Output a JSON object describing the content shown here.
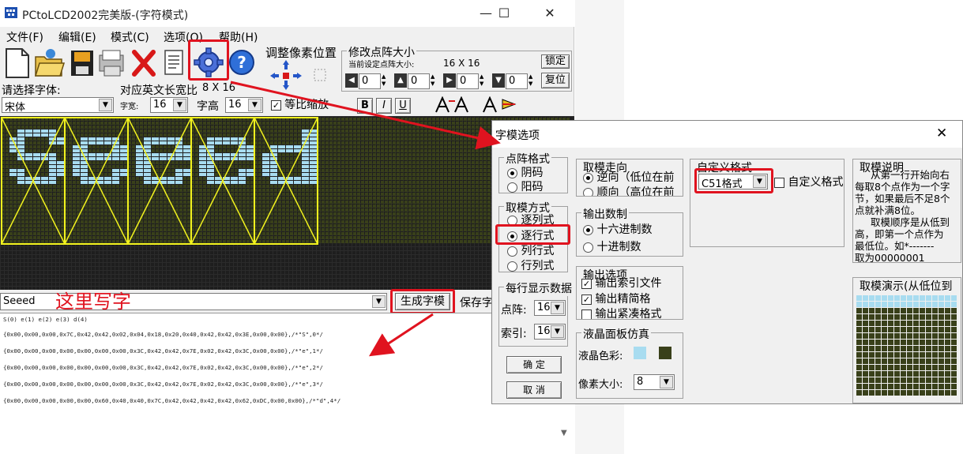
{
  "window": {
    "title": "PCtoLCD2002完美版-(字符模式)",
    "minimize": "—",
    "maximize": "☐",
    "close": "✕"
  },
  "menu": [
    "文件(F)",
    "编辑(E)",
    "模式(C)",
    "选项(O)",
    "帮助(H)"
  ],
  "adjust": {
    "title": "调整像素位置"
  },
  "matrix": {
    "title": "修改点阵大小",
    "current_label": "当前设定点阵大小:",
    "current_value": "16  X  16",
    "lock_button": "锁定",
    "restore_button": "复位",
    "spin_values": [
      "0",
      "0",
      "0",
      "0"
    ]
  },
  "font": {
    "select_label": "请选择字体:",
    "value": "宋体",
    "width_label": "对应英文长宽比",
    "width_ratio": "8  X  16",
    "char_width_label": "字宽:",
    "char_width": "16",
    "char_height_label": "字高",
    "char_height": "16",
    "proportional_label": "等比缩放",
    "bold": "B",
    "italic": "I",
    "underline": "U"
  },
  "lcd": {
    "text": "Seeed",
    "pixel_on": "#a8dcf0",
    "pixel_off": "#39401a",
    "grid_bg": "#1e1e1e",
    "cell_line": "#f2f21e"
  },
  "input": {
    "text": "Seeed",
    "annotation": "这里写字",
    "generate_button": "生成字模",
    "save_button": "保存字"
  },
  "output": {
    "index_line": "S(0) e(1) e(2) e(3) d(4)",
    "lines": [
      "{0x00,0x00,0x00,0x7C,0x42,0x42,0x02,0x04,0x18,0x20,0x40,0x42,0x42,0x3E,0x00,0x00},/*\"S\",0*/",
      "{0x00,0x00,0x00,0x00,0x00,0x00,0x00,0x3C,0x42,0x42,0x7E,0x02,0x42,0x3C,0x00,0x00},/*\"e\",1*/",
      "{0x00,0x00,0x00,0x00,0x00,0x00,0x00,0x3C,0x42,0x42,0x7E,0x02,0x42,0x3C,0x00,0x00},/*\"e\",2*/",
      "{0x00,0x00,0x00,0x00,0x00,0x00,0x00,0x3C,0x42,0x42,0x7E,0x02,0x42,0x3C,0x00,0x00},/*\"e\",3*/",
      "{0x00,0x00,0x00,0x00,0x00,0x60,0x40,0x40,0x7C,0x42,0x42,0x42,0x42,0x62,0xDC,0x00,0x00},/*\"d\",4*/"
    ]
  },
  "dialog": {
    "title": "字模选项",
    "close": "✕",
    "dot_format": {
      "title": "点阵格式",
      "options": [
        "阴码",
        "阳码"
      ],
      "selected": 0
    },
    "mode": {
      "title": "取模方式",
      "options": [
        "逐列式",
        "逐行式",
        "列行式",
        "行列式"
      ],
      "selected": 1
    },
    "per_line": {
      "title": "每行显示数据",
      "dot_label": "点阵:",
      "dot_value": "16",
      "index_label": "索引:",
      "index_value": "16"
    },
    "ok_button": "确    定",
    "cancel_button": "取    消",
    "direction": {
      "title": "取模走向",
      "options": [
        "逆向（低位在前",
        "顺向（高位在前"
      ],
      "selected": 0
    },
    "number": {
      "title": "输出数制",
      "options": [
        "十六进制数",
        "十进制数"
      ],
      "selected": 0
    },
    "output_opts": {
      "title": "输出选项",
      "items": [
        "输出索引文件",
        "输出精简格",
        "输出紧凑格式"
      ],
      "checked": [
        true,
        true,
        false
      ]
    },
    "lcd_sim": {
      "title": "液晶面板仿真",
      "color_label": "液晶色彩:",
      "pixel_label": "像素大小:",
      "pixel_value": "8",
      "color_a": "#a8dcf0",
      "color_b": "#39401a"
    },
    "custom": {
      "title": "自定义格式",
      "format_value": "C51格式",
      "custom_label": "自定义格式"
    },
    "desc": {
      "title": "取模说明",
      "lines": [
        "从第一行开始向右",
        "每取8个点作为一个字",
        "节，如果最后不足8个",
        "点就补满8位。",
        "取模顺序是从低到",
        "高，即第一个点作为",
        "最低位。如*-------",
        "取为00000001"
      ]
    },
    "demo": {
      "title": "取模演示(从低位到"
    }
  }
}
